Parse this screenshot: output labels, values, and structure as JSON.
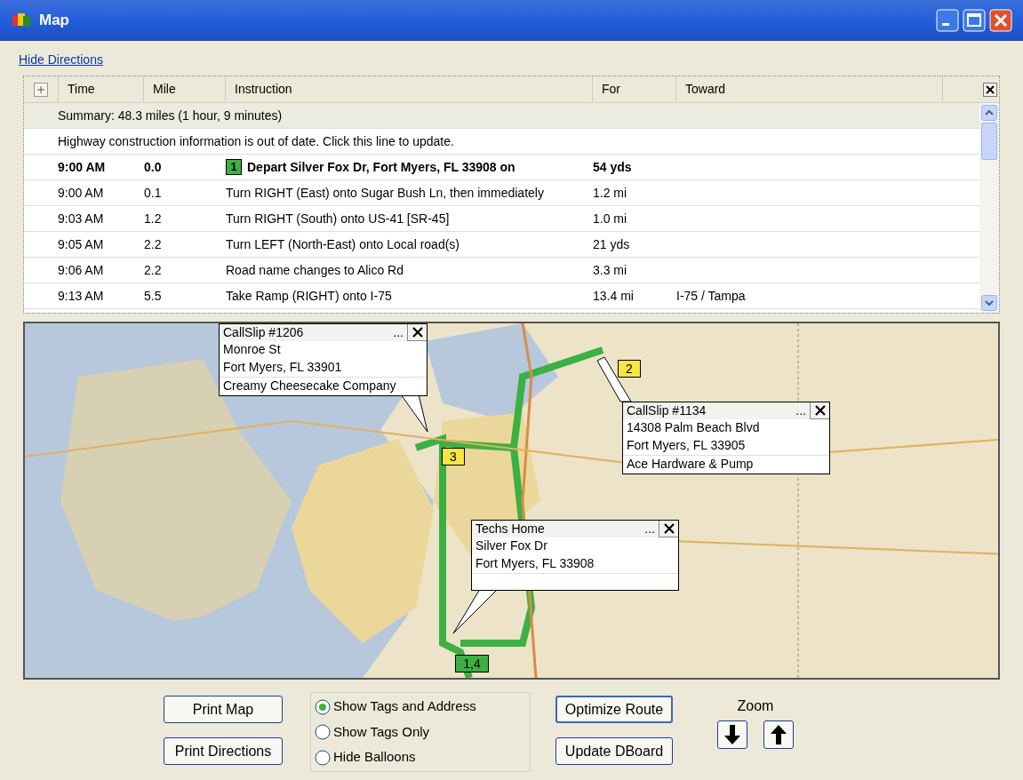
{
  "window": {
    "title": "Map"
  },
  "hide_directions_link": "Hide Directions",
  "directions": {
    "columns": [
      "Time",
      "Mile",
      "Instruction",
      "For",
      "Toward"
    ],
    "summary": "Summary:  48.3 miles (1 hour, 9 minutes)",
    "notice": "Highway construction information is out of date.  Click this line to update.",
    "rows": [
      {
        "time": "9:00 AM",
        "mile": "0.0",
        "step": "1",
        "instruction": "Depart Silver Fox Dr, Fort Myers, FL 33908 on",
        "for": "54 yds",
        "current": true
      },
      {
        "time": "9:00 AM",
        "mile": "0.1",
        "instruction": "Turn RIGHT (East) onto Sugar Bush Ln, then immediately",
        "for": "1.2 mi",
        "current": false
      },
      {
        "time": "9:03 AM",
        "mile": "1.2",
        "instruction": "Turn RIGHT (South) onto US-41 [SR-45]",
        "for": "1.0 mi",
        "current": false
      },
      {
        "time": "9:05 AM",
        "mile": "2.2",
        "instruction": "Turn LEFT (North-East) onto Local road(s)",
        "for": "21 yds",
        "current": false
      },
      {
        "time": "9:06 AM",
        "mile": "2.2",
        "instruction": "Road name changes to Alico Rd",
        "for": "3.3 mi",
        "current": false
      },
      {
        "time": "9:13 AM",
        "mile": "5.5",
        "instruction": "Take Ramp (RIGHT) onto I-75",
        "for": "13.4 mi",
        "toward": "I-75 / Tampa",
        "current": false
      }
    ]
  },
  "map": {
    "markers": [
      {
        "label": "2",
        "color": "#f5e642"
      },
      {
        "label": "3",
        "color": "#f5e642"
      },
      {
        "label": "1,4",
        "color": "#3cb043"
      }
    ],
    "balloons": [
      {
        "title": "CallSlip #1206",
        "more": "...",
        "lines": [
          "Monroe St",
          "Fort Myers, FL 33901",
          "Creamy Cheesecake Company"
        ]
      },
      {
        "title": "CallSlip #1134",
        "more": "...",
        "lines": [
          "14308 Palm Beach Blvd",
          "Fort Myers, FL 33905",
          "Ace Hardware & Pump"
        ]
      },
      {
        "title": "Techs Home",
        "more": "...",
        "lines": [
          "Silver Fox Dr",
          "Fort Myers, FL 33908"
        ]
      }
    ]
  },
  "buttons": {
    "print_map": "Print Map",
    "print_directions": "Print Directions",
    "optimize_route": "Optimize Route",
    "update_dboard": "Update DBoard"
  },
  "display_options": [
    {
      "label": "Show Tags and Address",
      "selected": true
    },
    {
      "label": "Show Tags Only",
      "selected": false
    },
    {
      "label": "Hide Balloons",
      "selected": false
    }
  ],
  "zoom": {
    "label": "Zoom"
  }
}
